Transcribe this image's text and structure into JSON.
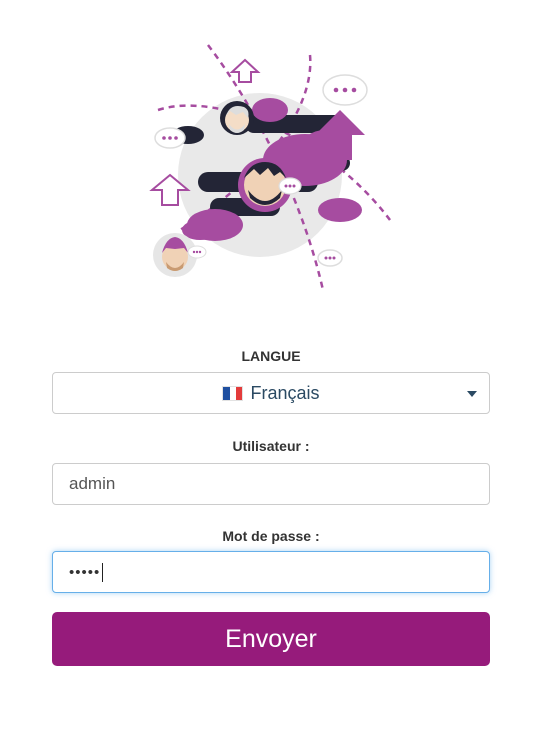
{
  "colors": {
    "accent": "#961b7b",
    "cloud": "#a64ca0",
    "dark": "#232536",
    "focus_border": "#66afe9"
  },
  "language": {
    "label": "LANGUE",
    "selected": "Français",
    "flag_icon": "flag-fr-icon"
  },
  "username": {
    "label": "Utilisateur :",
    "value": "admin"
  },
  "password": {
    "label": "Mot de passe :",
    "masked_value": "•••••"
  },
  "submit": {
    "label": "Envoyer"
  }
}
